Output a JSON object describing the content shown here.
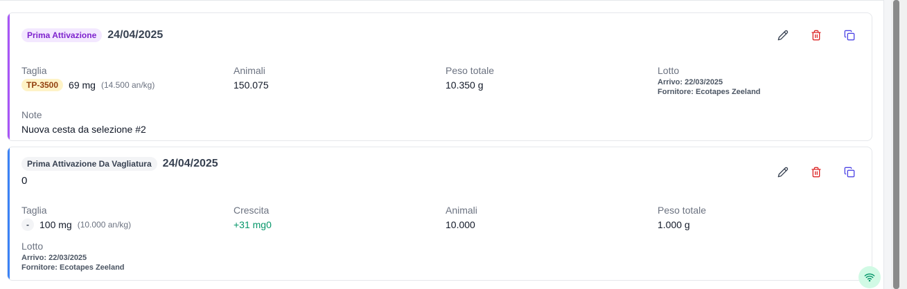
{
  "colors": {
    "purple_accent": "#a855f7",
    "blue_accent": "#3b82f6",
    "edit_icon": "#374151",
    "delete_icon": "#dc2626",
    "duplicate_icon": "#4f46e5",
    "growth_text": "#059669"
  },
  "icons": {
    "edit": "pencil-icon",
    "delete": "trash-icon",
    "duplicate": "copy-icon",
    "connection": "wifi-icon"
  },
  "cards": [
    {
      "badge": "Prima Attivazione",
      "date": "24/04/2025",
      "taglia_label": "Taglia",
      "size_code": "TP-3500",
      "size_weight": "69 mg",
      "size_perkg": "(14.500 an/kg)",
      "animali_label": "Animali",
      "animali_value": "150.075",
      "peso_label": "Peso totale",
      "peso_value": "10.350 g",
      "lotto_label": "Lotto",
      "lotto_arrivo": "Arrivo: 22/03/2025",
      "lotto_fornitore": "Fornitore: Ecotapes Zeeland",
      "note_label": "Note",
      "note_value": "Nuova cesta da selezione #2"
    },
    {
      "badge": "Prima Attivazione Da Vagliatura",
      "date": "24/04/2025",
      "subvalue": "0",
      "taglia_label": "Taglia",
      "size_code": "-",
      "size_weight": "100 mg",
      "size_perkg": "(10.000 an/kg)",
      "crescita_label": "Crescita",
      "crescita_value": "+31 mg0",
      "animali_label": "Animali",
      "animali_value": "10.000",
      "peso_label": "Peso totale",
      "peso_value": "1.000 g",
      "lotto_label": "Lotto",
      "lotto_arrivo": "Arrivo: 22/03/2025",
      "lotto_fornitore": "Fornitore: Ecotapes Zeeland"
    }
  ]
}
